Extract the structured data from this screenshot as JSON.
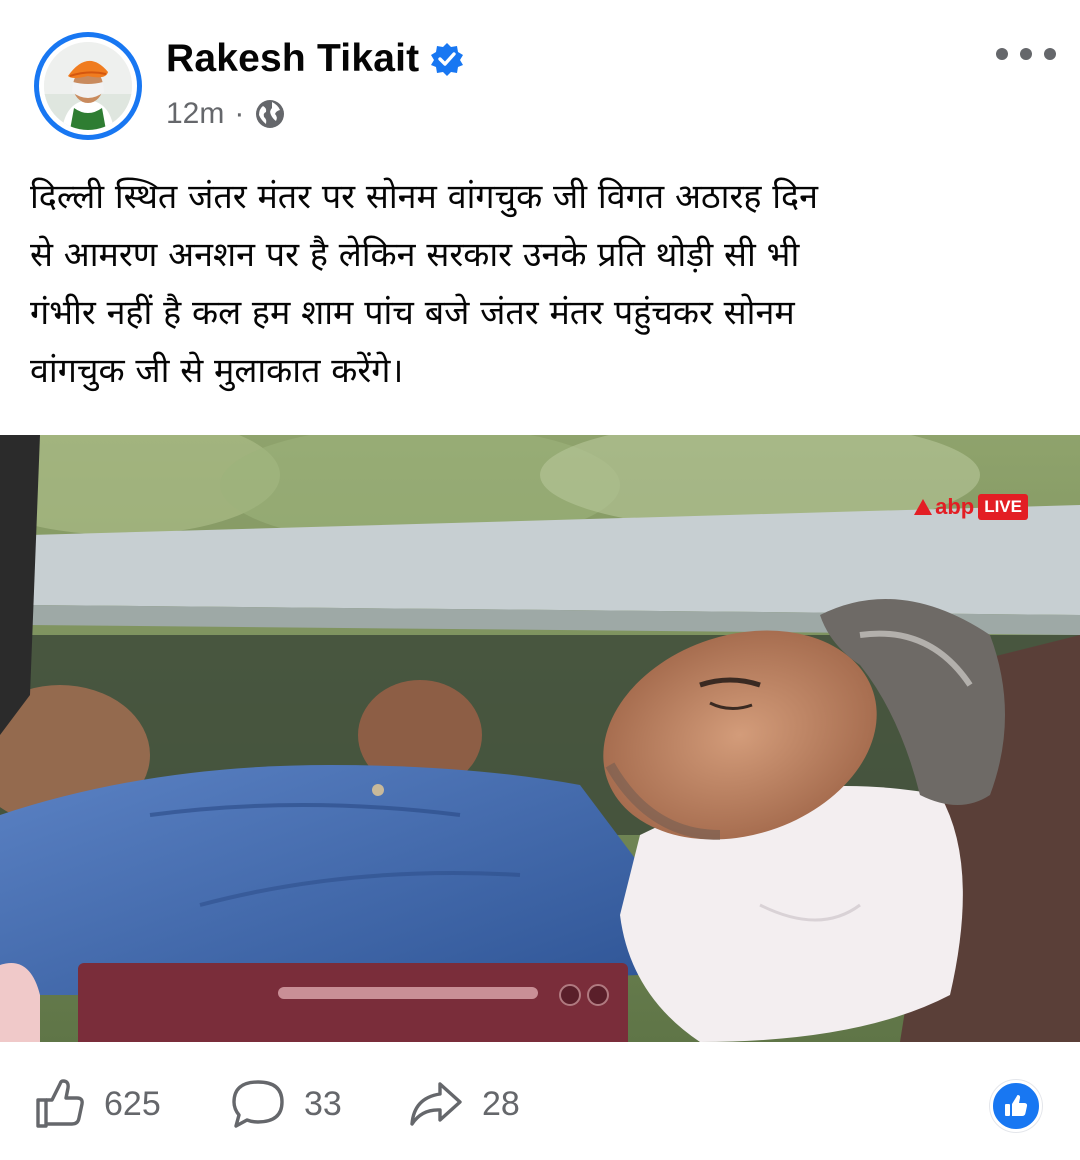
{
  "post": {
    "author": "Rakesh Tikait",
    "verified": true,
    "timestamp": "12m",
    "separator": "·",
    "audience_icon": "globe-icon",
    "text": "दिल्ली स्थित जंतर मंतर पर सोनम वांगचुक जी विगत अठारह दिन\nसे आमरण अनशन पर है लेकिन सरकार उनके प्रति थोड़ी सी भी\nगंभीर नहीं है कल हम शाम पांच बजे जंतर मंतर पहुंचकर सोनम\nवांगचुक जी से मुलाकात करेंगे।",
    "image": {
      "watermark_brand": "abp",
      "watermark_badge": "LIVE"
    }
  },
  "actions": {
    "likes": "625",
    "comments": "33",
    "shares": "28"
  },
  "colors": {
    "accent": "#1877f2",
    "secondary_text": "#65676b",
    "watermark_red": "#e31e24"
  }
}
